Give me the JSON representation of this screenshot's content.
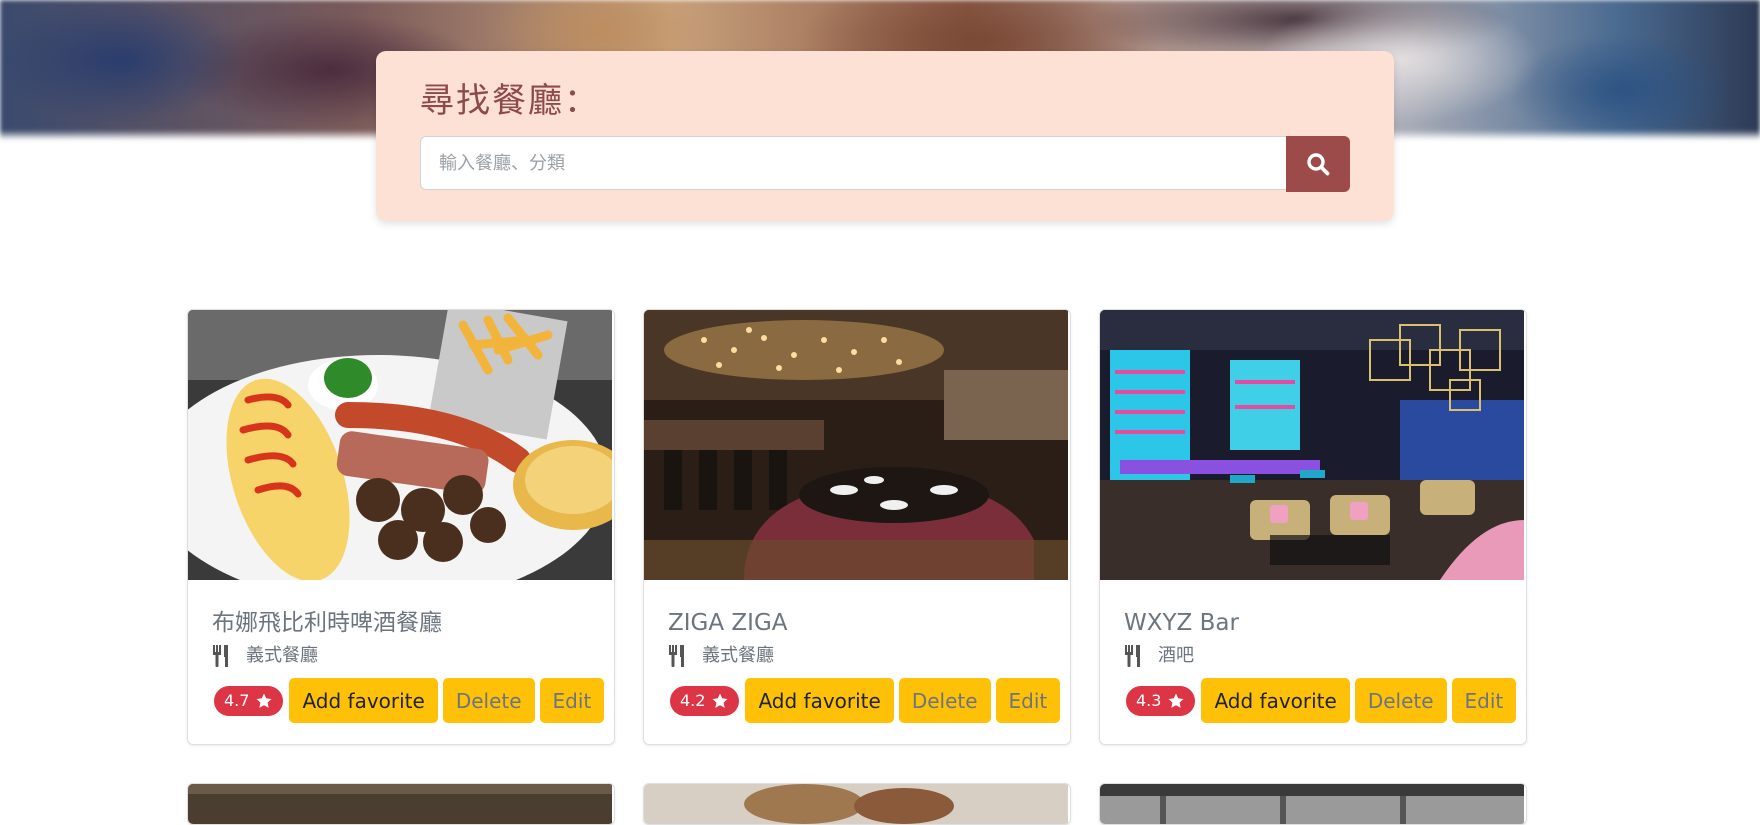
{
  "search": {
    "title": "尋找餐廳：",
    "placeholder": "輸入餐廳、分類",
    "value": "",
    "button_icon": "search-icon"
  },
  "colors": {
    "panel_bg": "#fde1d4",
    "title_color": "#8e4a4a",
    "search_button": "#9c4a4a",
    "rating_badge": "#dc3545",
    "action_button": "#ffc107"
  },
  "restaurants": [
    {
      "name": "布娜飛比利時啤酒餐廳",
      "category": "義式餐廳",
      "rating": "4.7",
      "image": "plate-with-omelette-sausage-fries"
    },
    {
      "name": "ZIGA ZIGA",
      "category": "義式餐廳",
      "rating": "4.2",
      "image": "restaurant-dining-room"
    },
    {
      "name": "WXYZ Bar",
      "category": "酒吧",
      "rating": "4.3",
      "image": "neon-bar-lounge"
    }
  ],
  "card_actions": {
    "favorite": "Add favorite",
    "delete": "Delete",
    "edit": "Edit"
  },
  "icons": {
    "category": "utensils-icon",
    "rating": "star-icon"
  }
}
